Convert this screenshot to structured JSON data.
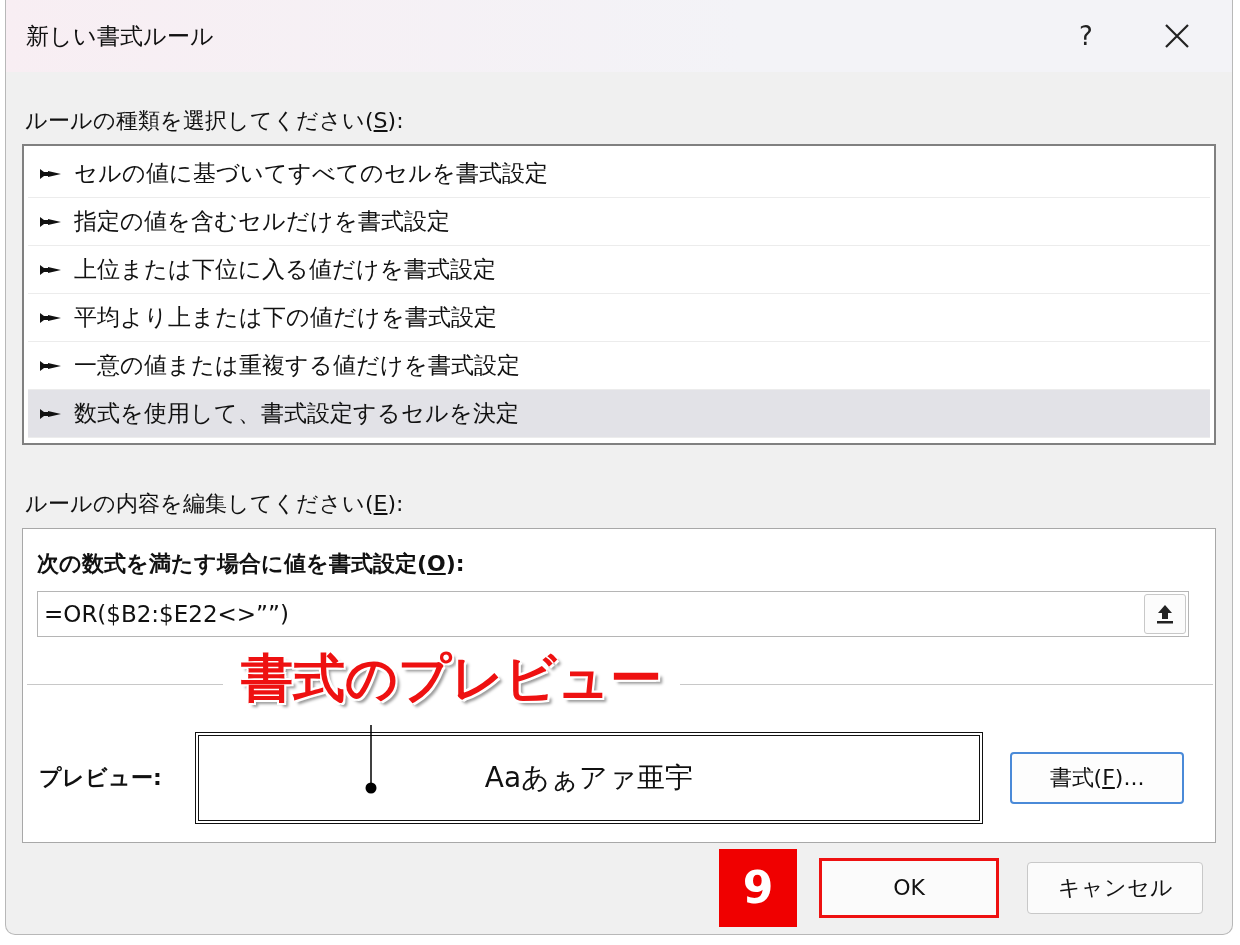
{
  "window": {
    "title": "新しい書式ルール",
    "help": "?"
  },
  "rule_type": {
    "label": {
      "before": "ルールの種類を選択してください(",
      "key": "S",
      "after": "):"
    },
    "items": [
      {
        "label": "セルの値に基づいてすべてのセルを書式設定",
        "selected": false
      },
      {
        "label": "指定の値を含むセルだけを書式設定",
        "selected": false
      },
      {
        "label": "上位または下位に入る値だけを書式設定",
        "selected": false
      },
      {
        "label": "平均より上または下の値だけを書式設定",
        "selected": false
      },
      {
        "label": "一意の値または重複する値だけを書式設定",
        "selected": false
      },
      {
        "label": "数式を使用して、書式設定するセルを決定",
        "selected": true
      }
    ]
  },
  "rule_edit": {
    "label": {
      "before": "ルールの内容を編集してください(",
      "key": "E",
      "after": "):"
    },
    "formula_label": {
      "before": "次の数式を満たす場合に値を書式設定(",
      "key": "O",
      "after": "):"
    },
    "formula": {
      "value": "=OR($B2:$E22<>””)"
    },
    "preview": {
      "label": "プレビュー:",
      "sample": "Aaあぁアァ亜宇"
    },
    "format_button": {
      "before": "書式(",
      "key": "F",
      "after": ")..."
    }
  },
  "buttons": [
    {
      "label": "OK",
      "highlighted": true
    },
    {
      "label": "キャンセル",
      "highlighted": false
    }
  ],
  "annotations": {
    "callout": "書式のプレビュー",
    "step": "9"
  }
}
